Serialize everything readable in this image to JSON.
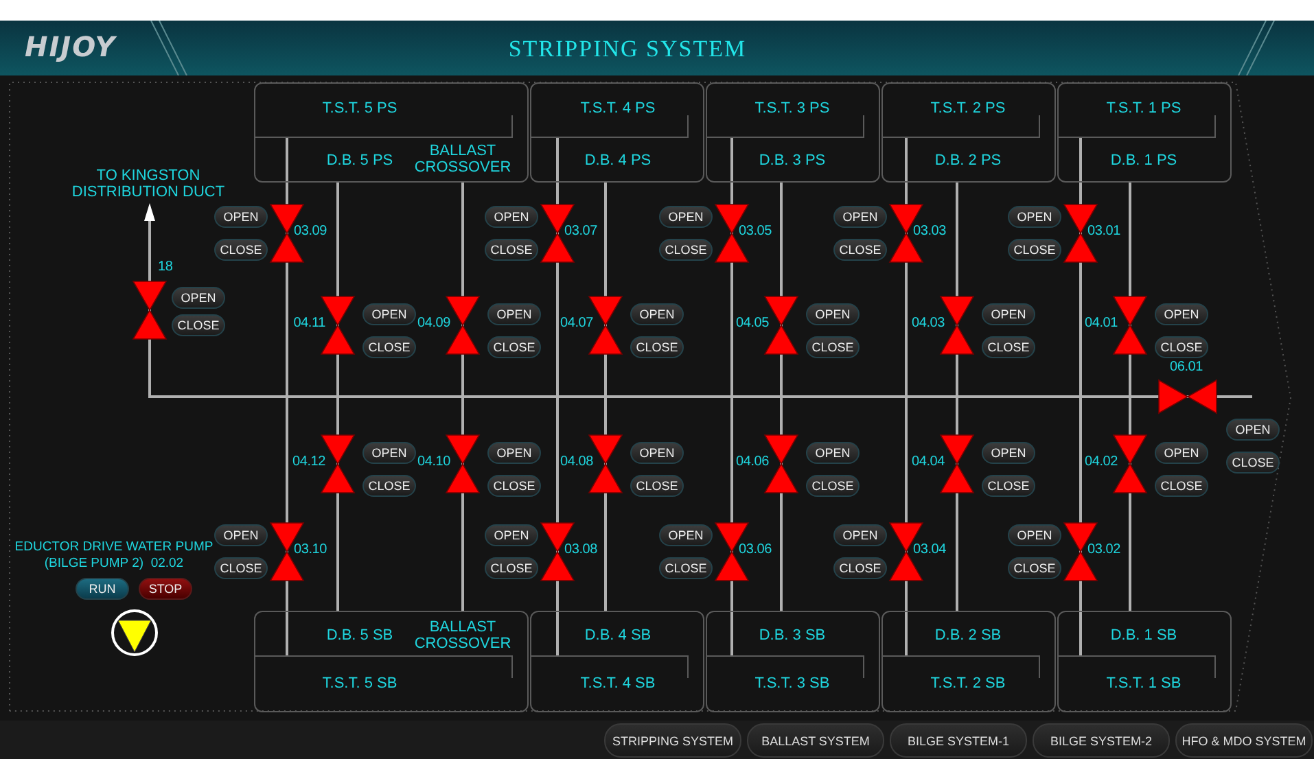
{
  "header": {
    "logo": "HIJOY",
    "title": "STRIPPING SYSTEM"
  },
  "outlet_label": [
    "TO KINGSTON",
    "DISTRIBUTION DUCT"
  ],
  "tanks_top": [
    {
      "tst": "T.S.T. 5 PS",
      "db": "D.B. 5 PS",
      "crossover": [
        "BALLAST",
        "CROSSOVER"
      ]
    },
    {
      "tst": "T.S.T. 4 PS",
      "db": "D.B. 4 PS"
    },
    {
      "tst": "T.S.T. 3 PS",
      "db": "D.B. 3 PS"
    },
    {
      "tst": "T.S.T. 2 PS",
      "db": "D.B. 2 PS"
    },
    {
      "tst": "T.S.T. 1 PS",
      "db": "D.B. 1 PS"
    }
  ],
  "tanks_bottom": [
    {
      "tst": "T.S.T. 5 SB",
      "db": "D.B. 5 SB",
      "crossover": [
        "BALLAST",
        "CROSSOVER"
      ]
    },
    {
      "tst": "T.S.T. 4 SB",
      "db": "D.B. 4 SB"
    },
    {
      "tst": "T.S.T. 3 SB",
      "db": "D.B. 3 SB"
    },
    {
      "tst": "T.S.T. 2 SB",
      "db": "D.B. 2 SB"
    },
    {
      "tst": "T.S.T. 1 SB",
      "db": "D.B. 1 SB"
    }
  ],
  "valves": [
    {
      "tag": "18",
      "open": false,
      "open_button": "OPEN",
      "close_button": "CLOSE"
    },
    {
      "tag": "03.09",
      "open": false,
      "open_button": "OPEN",
      "close_button": "CLOSE"
    },
    {
      "tag": "03.07",
      "open": false,
      "open_button": "OPEN",
      "close_button": "CLOSE"
    },
    {
      "tag": "03.05",
      "open": false,
      "open_button": "OPEN",
      "close_button": "CLOSE"
    },
    {
      "tag": "03.03",
      "open": false,
      "open_button": "OPEN",
      "close_button": "CLOSE"
    },
    {
      "tag": "03.01",
      "open": false,
      "open_button": "OPEN",
      "close_button": "CLOSE"
    },
    {
      "tag": "04.11",
      "open": false,
      "open_button": "OPEN",
      "close_button": "CLOSE"
    },
    {
      "tag": "04.09",
      "open": false,
      "open_button": "OPEN",
      "close_button": "CLOSE"
    },
    {
      "tag": "04.07",
      "open": false,
      "open_button": "OPEN",
      "close_button": "CLOSE"
    },
    {
      "tag": "04.05",
      "open": false,
      "open_button": "OPEN",
      "close_button": "CLOSE"
    },
    {
      "tag": "04.03",
      "open": false,
      "open_button": "OPEN",
      "close_button": "CLOSE"
    },
    {
      "tag": "04.01",
      "open": false,
      "open_button": "OPEN",
      "close_button": "CLOSE"
    },
    {
      "tag": "04.12",
      "open": false,
      "open_button": "OPEN",
      "close_button": "CLOSE"
    },
    {
      "tag": "04.10",
      "open": false,
      "open_button": "OPEN",
      "close_button": "CLOSE"
    },
    {
      "tag": "04.08",
      "open": false,
      "open_button": "OPEN",
      "close_button": "CLOSE"
    },
    {
      "tag": "04.06",
      "open": false,
      "open_button": "OPEN",
      "close_button": "CLOSE"
    },
    {
      "tag": "04.04",
      "open": false,
      "open_button": "OPEN",
      "close_button": "CLOSE"
    },
    {
      "tag": "04.02",
      "open": false,
      "open_button": "OPEN",
      "close_button": "CLOSE"
    },
    {
      "tag": "03.10",
      "open": false,
      "open_button": "OPEN",
      "close_button": "CLOSE"
    },
    {
      "tag": "03.08",
      "open": false,
      "open_button": "OPEN",
      "close_button": "CLOSE"
    },
    {
      "tag": "03.06",
      "open": false,
      "open_button": "OPEN",
      "close_button": "CLOSE"
    },
    {
      "tag": "03.04",
      "open": false,
      "open_button": "OPEN",
      "close_button": "CLOSE"
    },
    {
      "tag": "03.02",
      "open": false,
      "open_button": "OPEN",
      "close_button": "CLOSE"
    },
    {
      "tag": "06.01",
      "open": false,
      "open_button": "OPEN",
      "close_button": "CLOSE"
    }
  ],
  "pump": {
    "label": [
      "EDUCTOR DRIVE WATER PUMP",
      "(BILGE PUMP 2)  02.02"
    ],
    "run_button": "RUN",
    "stop_button": "STOP"
  },
  "nav_tabs": [
    "STRIPPING SYSTEM",
    "BALLAST SYSTEM",
    "BILGE SYSTEM-1",
    "BILGE SYSTEM-2",
    "HFO & MDO SYSTEM"
  ]
}
